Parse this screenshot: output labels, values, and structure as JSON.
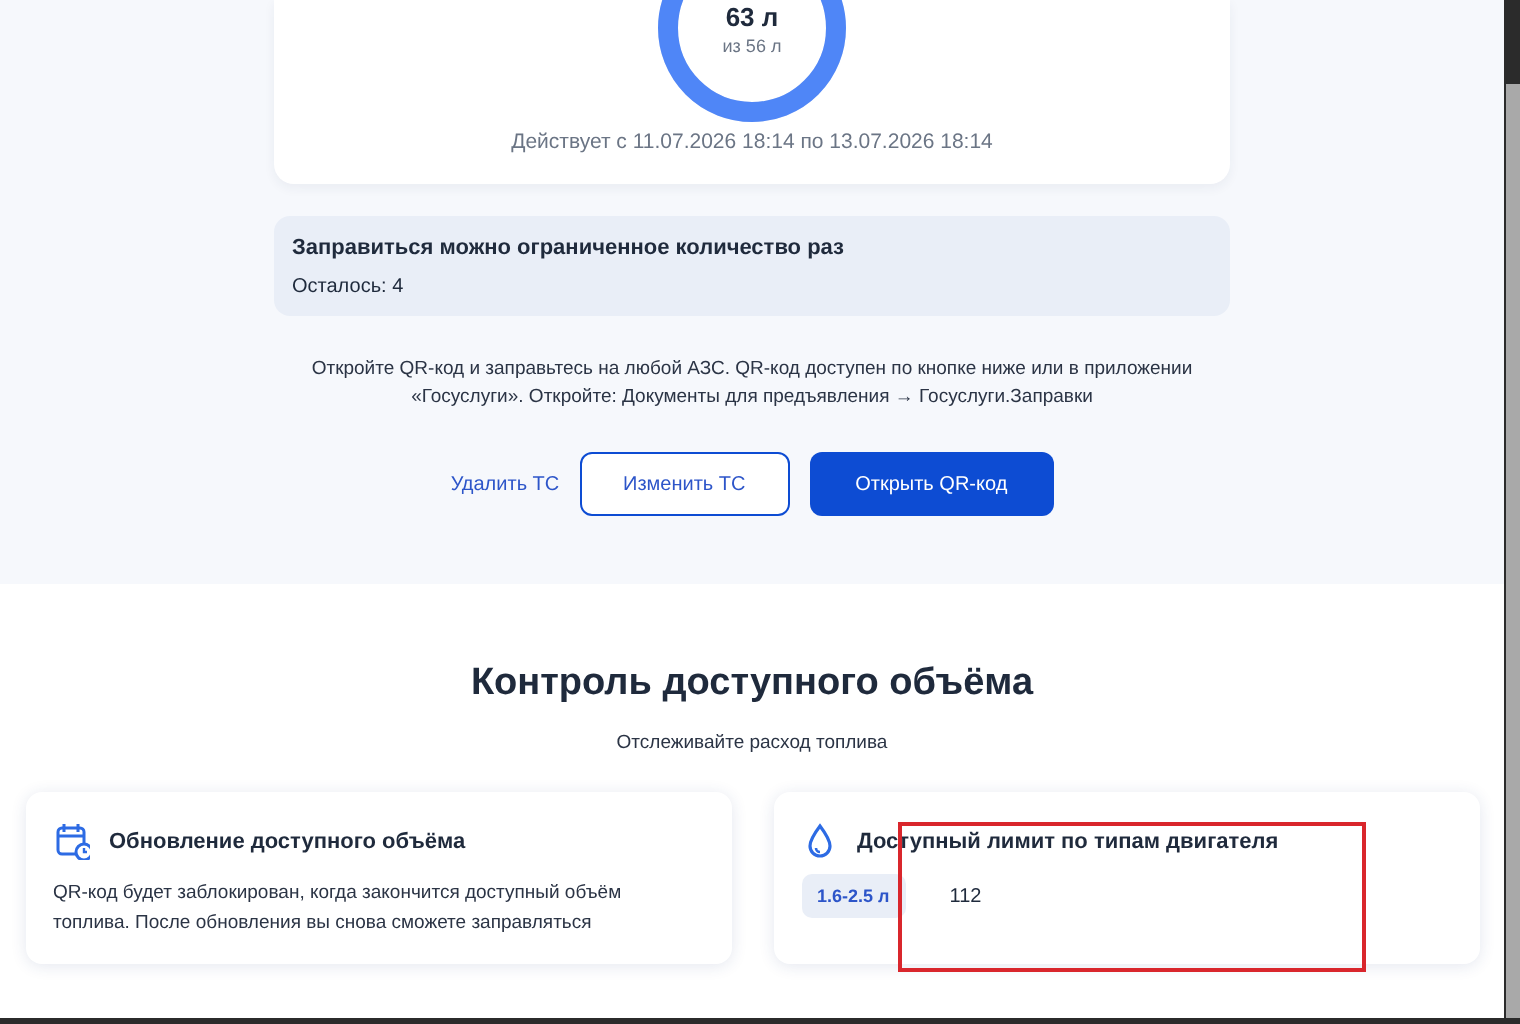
{
  "volume_card": {
    "amount": "63 л",
    "total": "из 56 л",
    "validity": "Действует с 11.07.2026 18:14 по 13.07.2026 18:14"
  },
  "limit_notice": {
    "title": "Заправиться можно ограниченное количество раз",
    "remaining": "Осталось: 4"
  },
  "instructions": "Откройте QR-код и заправьтесь на любой АЗС. QR-код доступен по кнопке ниже или в приложении «Госуслуги». Откройте: Документы для предъявления → Госуслуги.Заправки",
  "actions": [
    {
      "label": "Удалить ТС",
      "kind": "link"
    },
    {
      "label": "Изменить ТС",
      "kind": "outline"
    },
    {
      "label": "Открыть QR-код",
      "kind": "primary"
    }
  ],
  "control_section": {
    "title": "Контроль доступного объёма",
    "subtitle": "Отслеживайте расход топлива",
    "cards": [
      {
        "kind": "calendar",
        "title": "Обновление доступного объёма",
        "text": "QR-код будет заблокирован, когда закончится доступный объём топлива. После обновления вы снова сможете заправляться"
      },
      {
        "kind": "drop",
        "title": "Доступный лимит по типам двигателя",
        "limits": [
          {
            "engine": "1.6-2.5 л",
            "value": "112"
          }
        ]
      }
    ]
  }
}
